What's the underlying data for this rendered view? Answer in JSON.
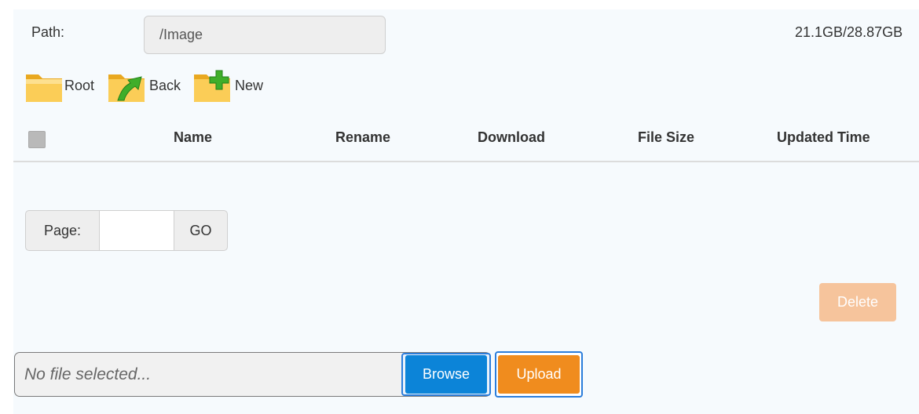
{
  "path": {
    "label": "Path:",
    "value": "/Image"
  },
  "storage": {
    "text": "21.1GB/28.87GB"
  },
  "nav": {
    "root_label": "Root",
    "back_label": "Back",
    "new_label": "New",
    "root_icon": "folder-icon",
    "back_icon": "folder-up-arrow-icon",
    "new_icon": "folder-add-icon"
  },
  "table": {
    "columns": [
      "Name",
      "Rename",
      "Download",
      "File Size",
      "Updated Time"
    ],
    "rows": []
  },
  "pagination": {
    "label": "Page:",
    "value": "",
    "go_label": "GO"
  },
  "actions": {
    "delete_label": "Delete"
  },
  "upload": {
    "placeholder": "No file selected...",
    "browse_label": "Browse",
    "upload_label": "Upload"
  },
  "colors": {
    "panel_bg": "#f6fafd",
    "browse": "#0c84d8",
    "upload": "#f08c1e",
    "delete_disabled": "#f6c49c",
    "focus_outline": "#2b7ddb"
  }
}
